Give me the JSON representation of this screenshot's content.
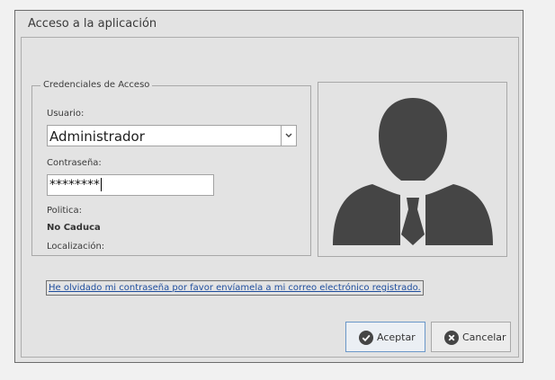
{
  "window": {
    "title": "Acceso a la aplicación"
  },
  "credentials": {
    "group_title": "Credenciales de Acceso",
    "user_label": "Usuario:",
    "user_value": "Administrador",
    "password_label": "Contraseña:",
    "password_value": "********",
    "policy_label": "Politica:",
    "policy_value": "No Caduca",
    "location_label": "Localización:"
  },
  "avatar": {
    "icon": "user-avatar-icon"
  },
  "forgot_link": "He olvidado mi contraseña por favor envíamela a mi correo electrónico registrado.",
  "buttons": {
    "accept_label": "Aceptar",
    "accept_icon": "check-circle-icon",
    "cancel_label": "Cancelar",
    "cancel_icon": "x-circle-icon"
  },
  "colors": {
    "icon_dark": "#454545",
    "link": "#1f4e9e",
    "accent_border": "#6a97c8"
  }
}
